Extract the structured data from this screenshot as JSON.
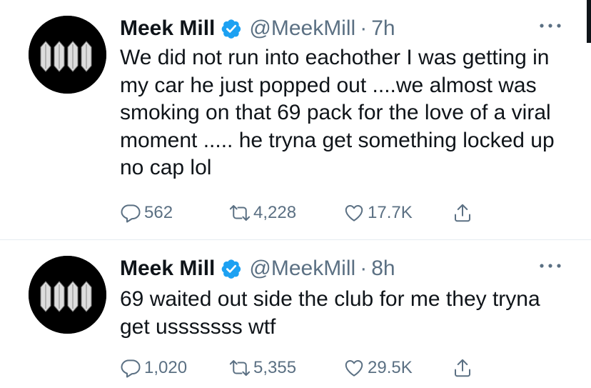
{
  "tweets": [
    {
      "author": {
        "name": "Meek Mill",
        "handle": "@MeekMill",
        "verified": true
      },
      "separator": "·",
      "time": "7h",
      "text": "We did not run into eachother I was getting in my car he just popped out ....we almost was smoking on that 69 pack for the love of a viral moment ..... he tryna get something locked up no cap lol",
      "stats": {
        "replies": "562",
        "retweets": "4,228",
        "likes": "17.7K"
      }
    },
    {
      "author": {
        "name": "Meek Mill",
        "handle": "@MeekMill",
        "verified": true
      },
      "separator": "·",
      "time": "8h",
      "text": "69 waited out side the club for me they tryna get usssssss wtf",
      "stats": {
        "replies": "1,020",
        "retweets": "5,355",
        "likes": "29.5K"
      }
    }
  ],
  "icons": {
    "reply": "reply-icon",
    "retweet": "retweet-icon",
    "like": "heart-icon",
    "share": "share-icon",
    "more": "more-icon",
    "verified": "verified-badge-icon"
  },
  "colors": {
    "verified": "#1da1f2",
    "secondary": "#5b7083",
    "text": "#0f1419"
  }
}
